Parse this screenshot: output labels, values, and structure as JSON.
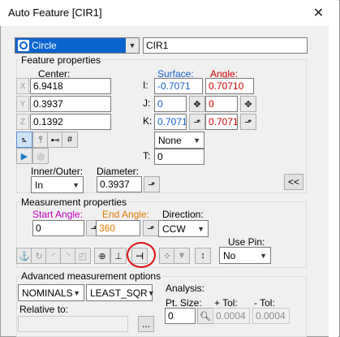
{
  "window": {
    "title": "Auto Feature [CIR1]",
    "close_glyph": "✕"
  },
  "feature": {
    "type": "Circle",
    "name": "CIR1"
  },
  "feature_properties": {
    "label": "Feature properties",
    "center_label": "Center:",
    "surface_label": "Surface:",
    "angle_label": "Angle:",
    "x_label": "X",
    "y_label": "Y",
    "z_label": "Z",
    "x": "6.9418",
    "y": "0.3937",
    "z": "0.1392",
    "i_label": "I:",
    "j_label": "J:",
    "k_label": "K:",
    "surface_i": "-0.7071",
    "surface_j": "0",
    "surface_k": "0.70710",
    "angle_i": "0.70710",
    "angle_j": "0",
    "angle_k": "0.70710",
    "none_option": "None",
    "t_label": "T:",
    "t_value": "0",
    "inner_outer_label": "Inner/Outer:",
    "inner_outer": "In",
    "diameter_label": "Diameter:",
    "diameter": "0.3937",
    "collapse_label": "<<"
  },
  "measurement_properties": {
    "label": "Measurement properties",
    "start_angle_label": "Start Angle:",
    "start_angle": "0",
    "end_angle_label": "End Angle:",
    "end_angle": "360",
    "direction_label": "Direction:",
    "direction": "CCW",
    "use_pin_label": "Use Pin:",
    "use_pin": "No"
  },
  "advanced": {
    "label": "Advanced measurement options",
    "nominals": "NOMINALS",
    "algorithm": "LEAST_SQR",
    "relative_to_label": "Relative to:",
    "browse_label": "...",
    "analysis_label": "Analysis:",
    "pt_size_label": "Pt. Size:",
    "pt_size": "0",
    "plus_tol_label": "+ Tol:",
    "plus_tol": "0.0004",
    "minus_tol_label": "- Tol:",
    "minus_tol": "0.0004"
  },
  "colors": {
    "surface": "#1760c8",
    "angle": "#d00000",
    "start_angle": "#c000c0",
    "end_angle": "#e07a00",
    "highlight_circle": "#e01010"
  }
}
